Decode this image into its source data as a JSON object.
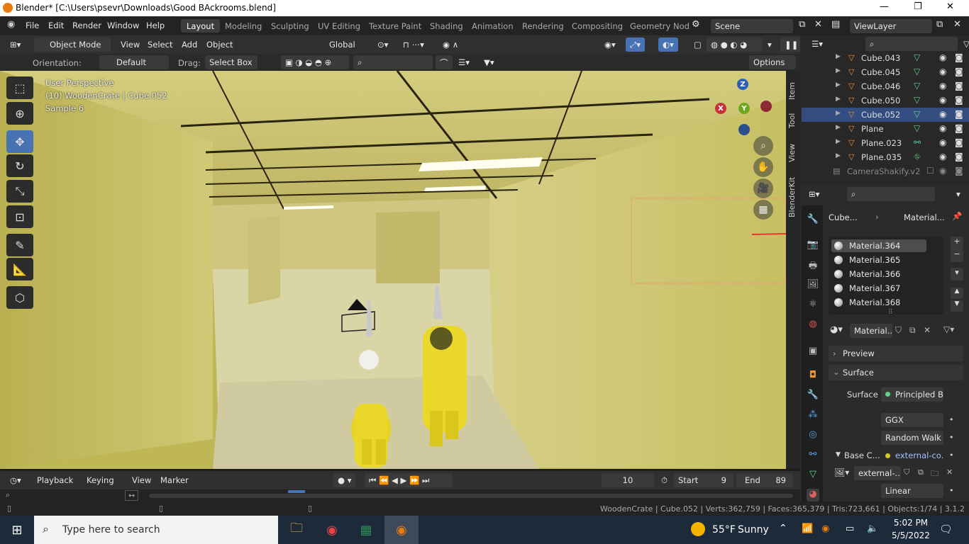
{
  "window": {
    "title": "Blender* [C:\\Users\\psevr\\Downloads\\Good BAckrooms.blend]",
    "minimize": "—",
    "maximize": "❐",
    "close": "✕"
  },
  "menu": {
    "items": [
      "File",
      "Edit",
      "Render",
      "Window",
      "Help"
    ]
  },
  "workspaces": {
    "tabs": [
      "Layout",
      "Modeling",
      "Sculpting",
      "UV Editing",
      "Texture Paint",
      "Shading",
      "Animation",
      "Rendering",
      "Compositing",
      "Geometry Nod"
    ],
    "active": "Layout"
  },
  "scene": {
    "name": "Scene",
    "view_layer": "ViewLayer"
  },
  "viewport_header": {
    "mode": "Object Mode",
    "menus": [
      "View",
      "Select",
      "Add",
      "Object"
    ],
    "transform": "Global"
  },
  "tool_settings": {
    "orientation_label": "Orientation:",
    "orientation_value": "Default",
    "drag_label": "Drag:",
    "drag_value": "Select Box",
    "options": "Options"
  },
  "viewport": {
    "overlay": [
      "User Perspective",
      "(10) WoodenCrate | Cube.052",
      "Sample 6"
    ],
    "axes": {
      "z": "Z",
      "y": "Y",
      "x": "X"
    }
  },
  "npanel_tabs": [
    "Item",
    "Tool",
    "View",
    "BlenderKit"
  ],
  "outliner": {
    "rows": [
      {
        "name": "Cube.043",
        "selected": false
      },
      {
        "name": "Cube.045",
        "selected": false
      },
      {
        "name": "Cube.046",
        "selected": false
      },
      {
        "name": "Cube.050",
        "selected": false
      },
      {
        "name": "Cube.052",
        "selected": true
      },
      {
        "name": "Plane",
        "selected": false
      },
      {
        "name": "Plane.023",
        "selected": false
      },
      {
        "name": "Plane.035",
        "selected": false
      }
    ],
    "extra_row": "CameraShakify.v2"
  },
  "properties": {
    "breadcrumb": [
      "Cube...",
      "Material..."
    ],
    "materials": [
      "Material.364",
      "Material.365",
      "Material.366",
      "Material.367",
      "Material.368"
    ],
    "selected_material": "Material.364",
    "material_slot": "Material...",
    "preview": "Preview",
    "surface_panel": "Surface",
    "surface_label": "Surface",
    "surface_value": "Principled B...",
    "distribution": "GGX",
    "subsurface": "Random Walk",
    "base_color_label": "Base C...",
    "base_color_value": "external-co...",
    "image_name": "external-...",
    "interpolation": "Linear"
  },
  "timeline": {
    "menus": [
      "Playback",
      "Keying",
      "View",
      "Marker"
    ],
    "current_frame": "10",
    "start_label": "Start",
    "start": "9",
    "end_label": "End",
    "end": "89"
  },
  "statusbar": {
    "text": "WoodenCrate | Cube.052 | Verts:362,759 | Faces:365,379 | Tris:723,661 | Objects:1/74 | 3.1.2"
  },
  "taskbar": {
    "search_placeholder": "Type here to search",
    "weather_temp": "55°F",
    "weather_desc": "Sunny",
    "time": "5:02 PM",
    "date": "5/5/2022"
  }
}
